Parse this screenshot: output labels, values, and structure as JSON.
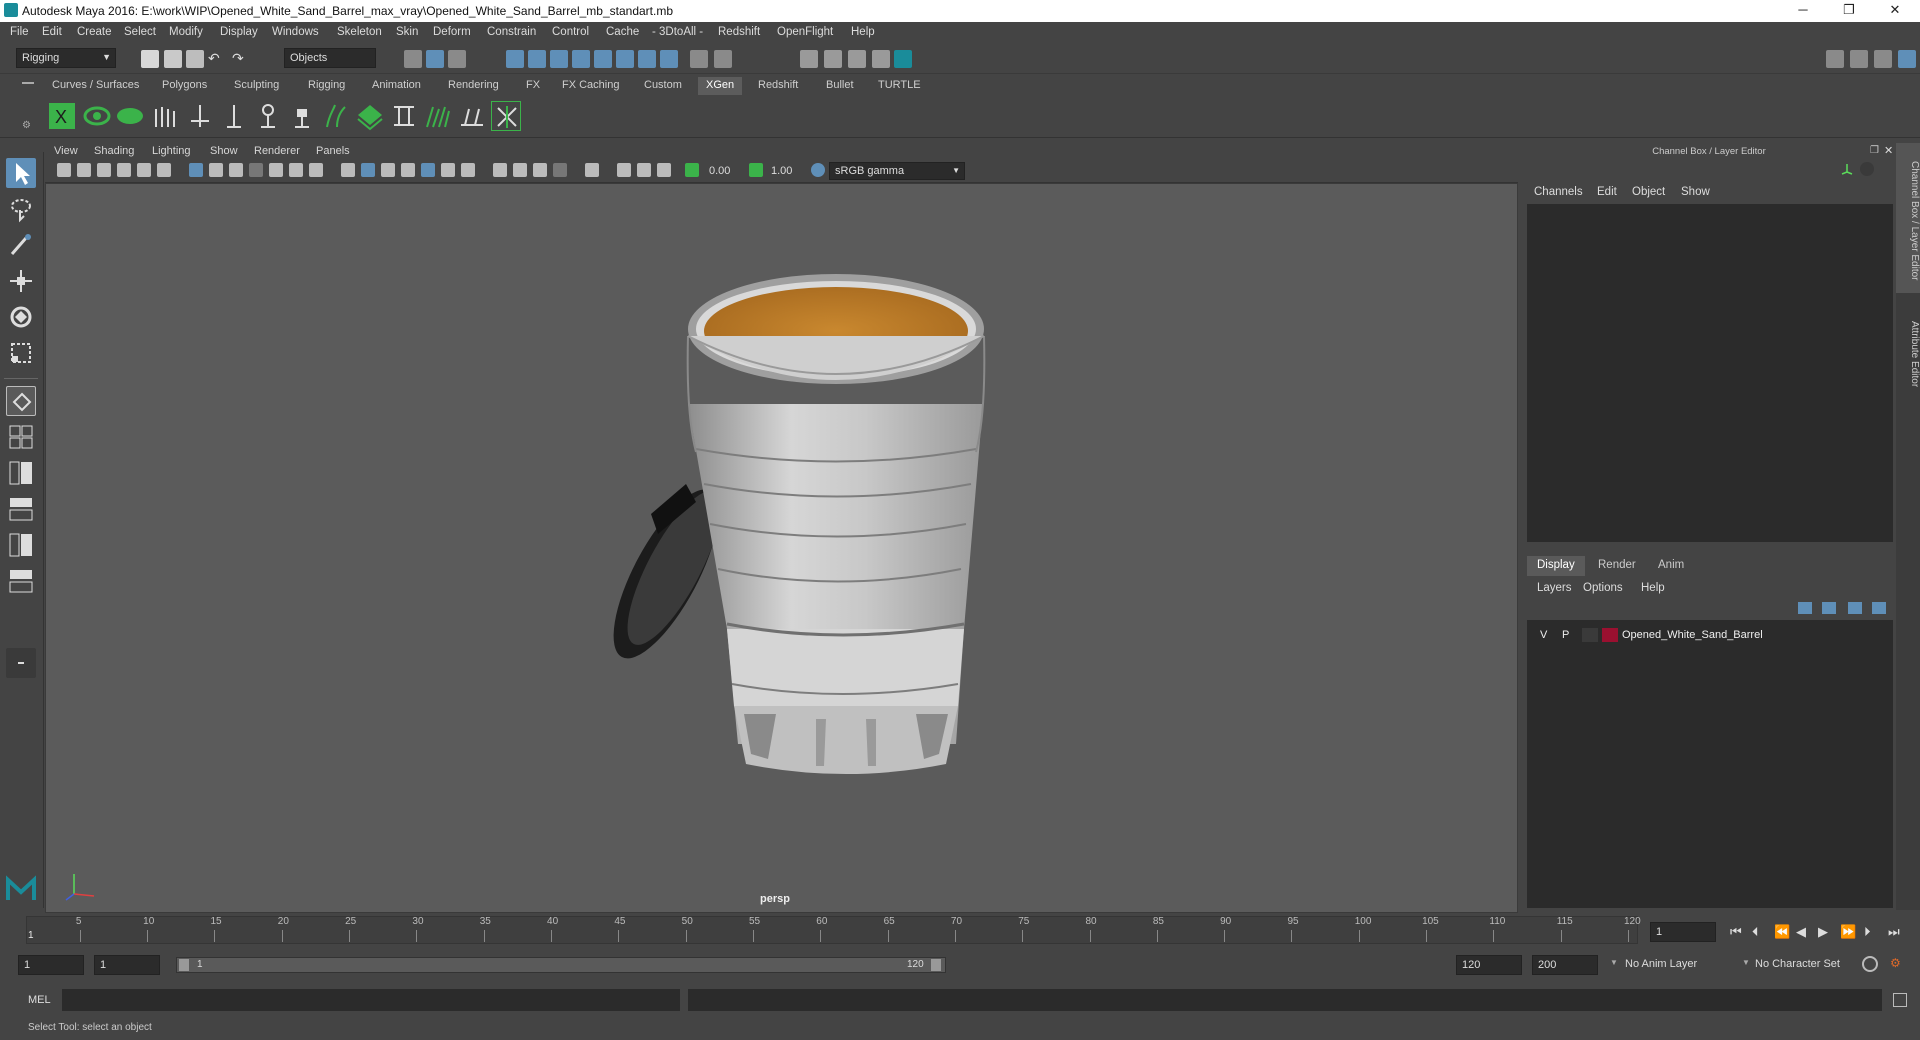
{
  "window": {
    "title": "Autodesk Maya 2016: E:\\work\\WIP\\Opened_White_Sand_Barrel_max_vray\\Opened_White_Sand_Barrel_mb_standart.mb",
    "minimize": "─",
    "maximize": "❐",
    "close": "✕"
  },
  "menubar": [
    "File",
    "Edit",
    "Create",
    "Select",
    "Modify",
    "Display",
    "Windows",
    "Skeleton",
    "Skin",
    "Deform",
    "Constrain",
    "Control",
    "Cache",
    "- 3DtoAll -",
    "Redshift",
    "OpenFlight",
    "Help"
  ],
  "statusline": {
    "menuset": "Rigging",
    "selection_mask": "Objects"
  },
  "shelf_tabs": [
    "Curves / Surfaces",
    "Polygons",
    "Sculpting",
    "Rigging",
    "Animation",
    "Rendering",
    "FX",
    "FX Caching",
    "Custom",
    "XGen",
    "Redshift",
    "Bullet",
    "TURTLE"
  ],
  "shelf_active": "XGen",
  "viewport": {
    "menus": [
      "View",
      "Shading",
      "Lighting",
      "Show",
      "Renderer",
      "Panels"
    ],
    "exposure": "0.00",
    "gamma": "1.00",
    "colorspace": "sRGB gamma",
    "camera_label": "persp"
  },
  "channel_box": {
    "title": "Channel Box / Layer Editor",
    "menus": [
      "Channels",
      "Edit",
      "Object",
      "Show"
    ]
  },
  "layer_editor": {
    "tabs": [
      "Display",
      "Render",
      "Anim"
    ],
    "active_tab": "Display",
    "menus": [
      "Layers",
      "Options",
      "Help"
    ],
    "layers": [
      {
        "visible": "V",
        "playback": "P",
        "color": "#9a1030",
        "name": "Opened_White_Sand_Barrel"
      }
    ]
  },
  "side_tabs": [
    "Channel Box / Layer Editor",
    "Attribute Editor"
  ],
  "timeline": {
    "ticks": [
      "5",
      "10",
      "15",
      "20",
      "25",
      "30",
      "35",
      "40",
      "45",
      "50",
      "55",
      "60",
      "65",
      "70",
      "75",
      "80",
      "85",
      "90",
      "95",
      "100",
      "105",
      "110",
      "115",
      "120"
    ],
    "start_label": "1",
    "current_frame": "1"
  },
  "range": {
    "start": "1",
    "playback_start": "1",
    "slider_start": "1",
    "slider_end": "120",
    "playback_end": "120",
    "end": "200",
    "anim_layer": "No Anim Layer",
    "character_set": "No Character Set"
  },
  "command_line": {
    "label": "MEL"
  },
  "help_line": "Select Tool: select an object",
  "colors": {
    "accent_teal": "#1a8c9a",
    "shelf_green": "#3bb34a",
    "layer_color": "#9a1030"
  }
}
